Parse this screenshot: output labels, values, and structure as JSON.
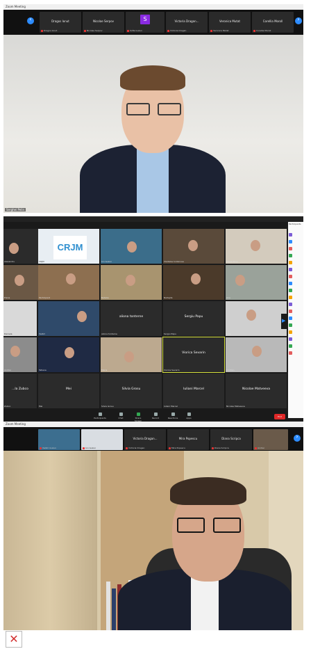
{
  "panel1": {
    "title": "Zoom Meeting",
    "thumbnails": [
      {
        "name": "Dragos Ionut",
        "sub": "Dragos Ionut"
      },
      {
        "name": "Nicolae Serpov",
        "sub": "Nicolae Serpov"
      },
      {
        "name": "",
        "sub": "Sofia Guzun",
        "badge": "S"
      },
      {
        "name": "Victoria Dragan...",
        "sub": "Victoria Dragan"
      },
      {
        "name": "Veronica Mutat",
        "sub": "Veronica Mutat"
      },
      {
        "name": "Corellia Moroll",
        "sub": "Corellia Moroll"
      }
    ],
    "speaker_label": "Serghei Pelin"
  },
  "panel2": {
    "tiles": [
      {
        "name": "",
        "cap": "Alexandru"
      },
      {
        "name": "",
        "cap": "CRJM",
        "logo": "CRJM"
      },
      {
        "name": "",
        "cap": "Ion Guzun"
      },
      {
        "name": "",
        "cap": "Vladislav Gribincea"
      },
      {
        "name": "",
        "cap": "Viorel Rusu"
      },
      {
        "name": "",
        "cap": "Elena"
      },
      {
        "name": "",
        "cap": "Participant"
      },
      {
        "name": "",
        "cap": "Natalia"
      },
      {
        "name": "",
        "cap": "Nadejda"
      },
      {
        "name": "",
        "cap": "Ana"
      },
      {
        "name": "",
        "cap": "Daniela"
      },
      {
        "name": "",
        "cap": "Vadim"
      },
      {
        "name": "aliona tonterne",
        "cap": "aliona tonterne"
      },
      {
        "name": "Sergiu Papu",
        "cap": "Sergiu Papu"
      },
      {
        "name": "",
        "cap": "Iurie"
      },
      {
        "name": "",
        "cap": "Andrei"
      },
      {
        "name": "",
        "cap": "Tatiana"
      },
      {
        "name": "",
        "cap": "Maria"
      },
      {
        "name": "Viorica Sevarin",
        "cap": "Viorica Sevarin"
      },
      {
        "name": "",
        "cap": "Cristian"
      },
      {
        "name": "...la Zubco",
        "cap": "Zubco"
      },
      {
        "name": "Mei",
        "cap": "Mei"
      },
      {
        "name": "Silvia Grosu",
        "cap": "Silvia Grosu"
      },
      {
        "name": "Iuliani Marcel",
        "cap": "Iuliani Marcel"
      },
      {
        "name": "Nicolae Matveeva",
        "cap": "Nicolae Matveeva"
      }
    ],
    "controls": [
      "Participants",
      "Chat",
      "Share Screen",
      "Record",
      "Reactions",
      "Apps"
    ],
    "end_label": "End",
    "chat_panel_title": "Participants"
  },
  "panel3": {
    "title": "Zoom Meeting",
    "thumbnails": [
      {
        "name": "",
        "sub": "Vadim Guzun"
      },
      {
        "name": "",
        "sub": "Ion Guzun"
      },
      {
        "name": "Victoria Dragan...",
        "sub": "Victoria Dragan"
      },
      {
        "name": "Mira Popescu",
        "sub": "Mira Popescu"
      },
      {
        "name": "Diana Scripca",
        "sub": "Diana Scripca"
      },
      {
        "name": "",
        "sub": "Andrei"
      }
    ],
    "speaker_label": ""
  },
  "broken_image_icon": "broken-image-icon",
  "colors": {
    "accent": "#2d8cff",
    "end": "#e02828",
    "badge": "#8a2be2",
    "highlight": "#d7e23d"
  }
}
